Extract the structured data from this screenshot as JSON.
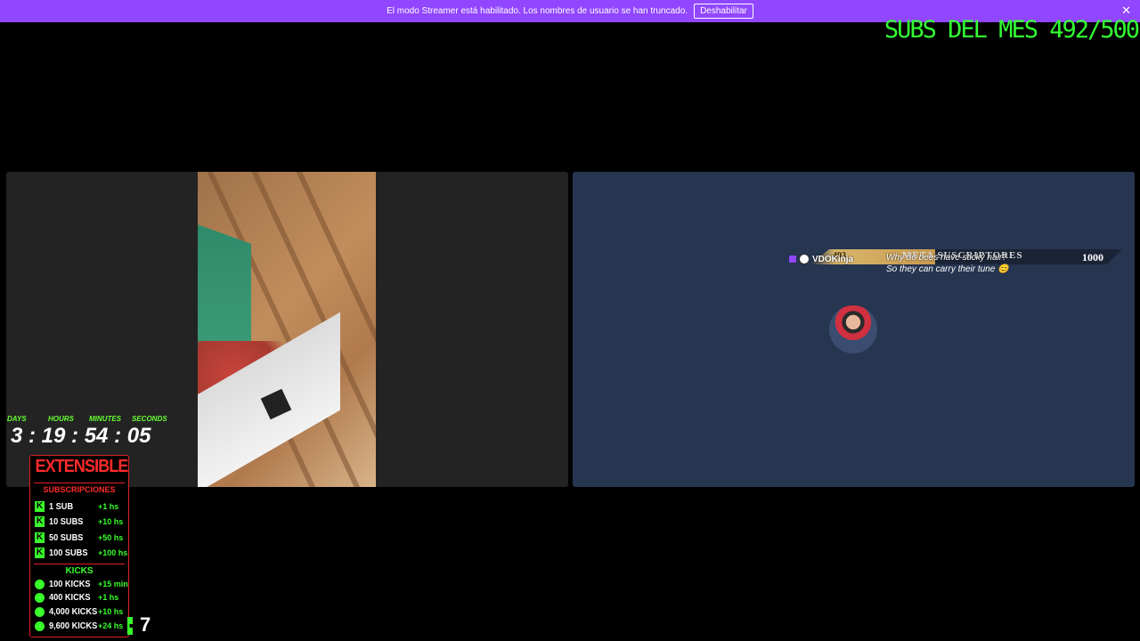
{
  "banner": {
    "message": "El modo Streamer está habilitado. Los nombres de usuario se han truncado.",
    "button_label": "Deshabilitar",
    "close_glyph": "✕"
  },
  "overlay": {
    "subs_del_mes": "SUBS DEL MES 492/500"
  },
  "goal_bar": {
    "current": "493",
    "label": "META SUSCRIPTORES",
    "target": "1000"
  },
  "chat": {
    "username": "VDOKinja",
    "message_line1": "Why do bees have sticky hair?",
    "message_line2": "So they can carry their tune 😊"
  },
  "timer": {
    "labels": [
      "DAYS",
      "HOURS",
      "MINUTES",
      "SECONDS"
    ],
    "value": "3 : 19 : 54 : 05"
  },
  "extensible": {
    "title": "EXTENSIBLE",
    "subs_header": "SUBSCRIPCIONES",
    "subs": [
      {
        "label": "1 SUB",
        "bonus": "+1 hs"
      },
      {
        "label": "10 SUBS",
        "bonus": "+10 hs"
      },
      {
        "label": "50 SUBS",
        "bonus": "+50 hs"
      },
      {
        "label": "100 SUBS",
        "bonus": "+100 hs"
      }
    ],
    "kicks_header": "KICKS",
    "kicks": [
      {
        "label": "100 KICKS",
        "bonus": "+15 min"
      },
      {
        "label": "400 KICKS",
        "bonus": "+1 hs"
      },
      {
        "label": "4,000 KICKS",
        "bonus": "+10 hs"
      },
      {
        "label": "9,600 KICKS",
        "bonus": "+24 hs"
      }
    ],
    "k_glyph": "K"
  },
  "bottom": {
    "number": "7"
  },
  "colors": {
    "twitch_purple": "#9146ff",
    "neon_green": "#33ff33",
    "accent_red": "#e01e28",
    "tile_dark": "#232323",
    "tile_blue": "#263550"
  }
}
